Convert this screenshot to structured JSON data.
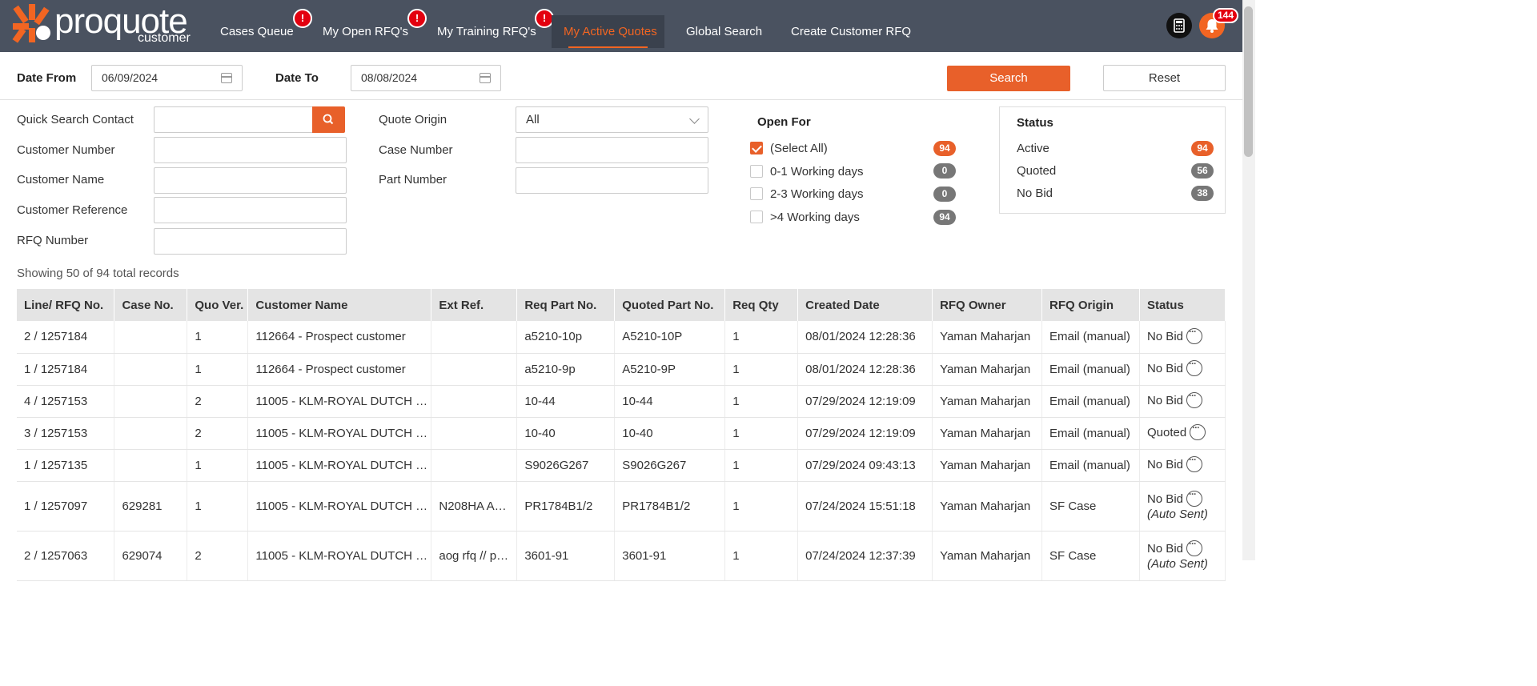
{
  "brand": {
    "name": "proquote",
    "sub": "customer"
  },
  "nav": {
    "items": [
      {
        "label": "Cases Queue",
        "badge": "!"
      },
      {
        "label": "My Open RFQ's",
        "badge": "!"
      },
      {
        "label": "My Training RFQ's",
        "badge": "!"
      },
      {
        "label": "My Active Quotes",
        "active": true
      },
      {
        "label": "Global Search"
      },
      {
        "label": "Create Customer RFQ"
      }
    ],
    "notifications": "144"
  },
  "dates": {
    "from_label": "Date From",
    "from_value": "06/09/2024",
    "to_label": "Date To",
    "to_value": "08/08/2024",
    "search_label": "Search",
    "reset_label": "Reset"
  },
  "filters": {
    "quick_search": "Quick Search Contact",
    "customer_number": "Customer Number",
    "customer_name": "Customer Name",
    "customer_reference": "Customer Reference",
    "rfq_number": "RFQ Number",
    "quote_origin": "Quote Origin",
    "quote_origin_value": "All",
    "case_number": "Case Number",
    "part_number": "Part Number"
  },
  "open_for": {
    "title": "Open For",
    "options": [
      {
        "label": "(Select All)",
        "count": "94",
        "checked": true
      },
      {
        "label": "0-1 Working days",
        "count": "0",
        "checked": false
      },
      {
        "label": "2-3 Working days",
        "count": "0",
        "checked": false
      },
      {
        "label": ">4 Working days",
        "count": "94",
        "checked": false
      }
    ]
  },
  "status_panel": {
    "title": "Status",
    "items": [
      {
        "label": "Active",
        "count": "94"
      },
      {
        "label": "Quoted",
        "count": "56"
      },
      {
        "label": "No Bid",
        "count": "38"
      }
    ]
  },
  "records_text": "Showing 50 of 94 total records",
  "table": {
    "headers": [
      "Line/ RFQ No.",
      "Case No.",
      "Quo Ver.",
      "Customer Name",
      "Ext Ref.",
      "Req Part No.",
      "Quoted Part No.",
      "Req Qty",
      "Created Date",
      "RFQ Owner",
      "RFQ Origin",
      "Status"
    ],
    "rows": [
      [
        "2 / 1257184",
        "",
        "1",
        "112664 - Prospect customer",
        "",
        "a5210-10p",
        "A5210-10P",
        "1",
        "08/01/2024 12:28:36",
        "Yaman Maharjan",
        "Email (manual)",
        "No Bid",
        ""
      ],
      [
        "1 / 1257184",
        "",
        "1",
        "112664 - Prospect customer",
        "",
        "a5210-9p",
        "A5210-9P",
        "1",
        "08/01/2024 12:28:36",
        "Yaman Maharjan",
        "Email (manual)",
        "No Bid",
        ""
      ],
      [
        "4 / 1257153",
        "",
        "2",
        "11005 - KLM-ROYAL DUTCH …",
        "",
        "10-44",
        "10-44",
        "1",
        "07/29/2024 12:19:09",
        "Yaman Maharjan",
        "Email (manual)",
        "No Bid",
        ""
      ],
      [
        "3 / 1257153",
        "",
        "2",
        "11005 - KLM-ROYAL DUTCH …",
        "",
        "10-40",
        "10-40",
        "1",
        "07/29/2024 12:19:09",
        "Yaman Maharjan",
        "Email (manual)",
        "Quoted",
        ""
      ],
      [
        "1 / 1257135",
        "",
        "1",
        "11005 - KLM-ROYAL DUTCH …",
        "",
        "S9026G267",
        "S9026G267",
        "1",
        "07/29/2024 09:43:13",
        "Yaman Maharjan",
        "Email (manual)",
        "No Bid",
        ""
      ],
      [
        "1 / 1257097",
        "629281",
        "1",
        "11005 - KLM-ROYAL DUTCH …",
        "N208HA A…",
        "PR1784B1/2",
        "PR1784B1/2",
        "1",
        "07/24/2024 15:51:18",
        "Yaman Maharjan",
        "SF Case",
        "No Bid",
        "(Auto Sent)"
      ],
      [
        "2 / 1257063",
        "629074",
        "2",
        "11005 - KLM-ROYAL DUTCH …",
        "aog rfq // p…",
        "3601-91",
        "3601-91",
        "1",
        "07/24/2024 12:37:39",
        "Yaman Maharjan",
        "SF Case",
        "No Bid",
        "(Auto Sent)"
      ]
    ]
  }
}
